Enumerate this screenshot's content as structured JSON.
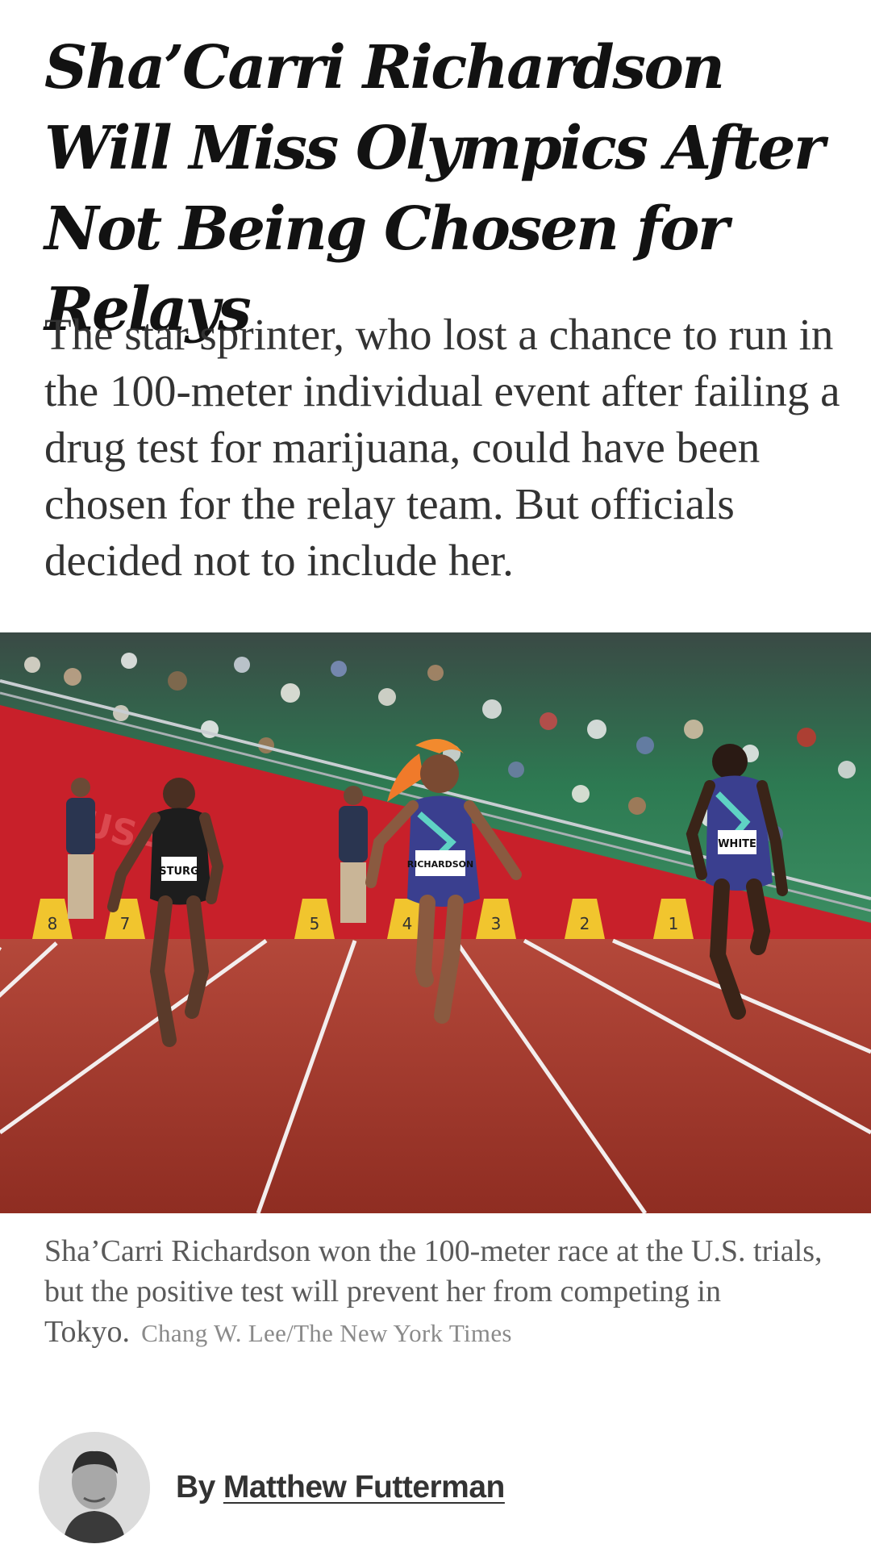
{
  "article": {
    "headline": "Sha’Carri Richardson Will Miss Olympics After Not Being Chosen for Relays",
    "summary": "The star sprinter, who lost a chance to run in the 100-meter individual event after failing a drug test for marijuana, could have been chosen for the relay team. But officials decided not to include her.",
    "photo": {
      "bib_labels": [
        "STURG",
        "RICHARDSON",
        "WHITE"
      ],
      "lane_markers": [
        "8",
        "7",
        "5",
        "4",
        "3",
        "2",
        "1"
      ],
      "caption": "Sha’Carri Richardson won the 100-meter race at the U.S. trials, but the positive test will prevent her from competing in Tokyo.",
      "credit": "Chang W. Lee/The New York Times"
    },
    "byline": {
      "prefix": "By",
      "author": "Matthew Futterman"
    }
  },
  "colors": {
    "track": "#a4392b",
    "banner": "#c8202a",
    "stands": "#2d7a52",
    "uniform": "#3a3f8f"
  }
}
